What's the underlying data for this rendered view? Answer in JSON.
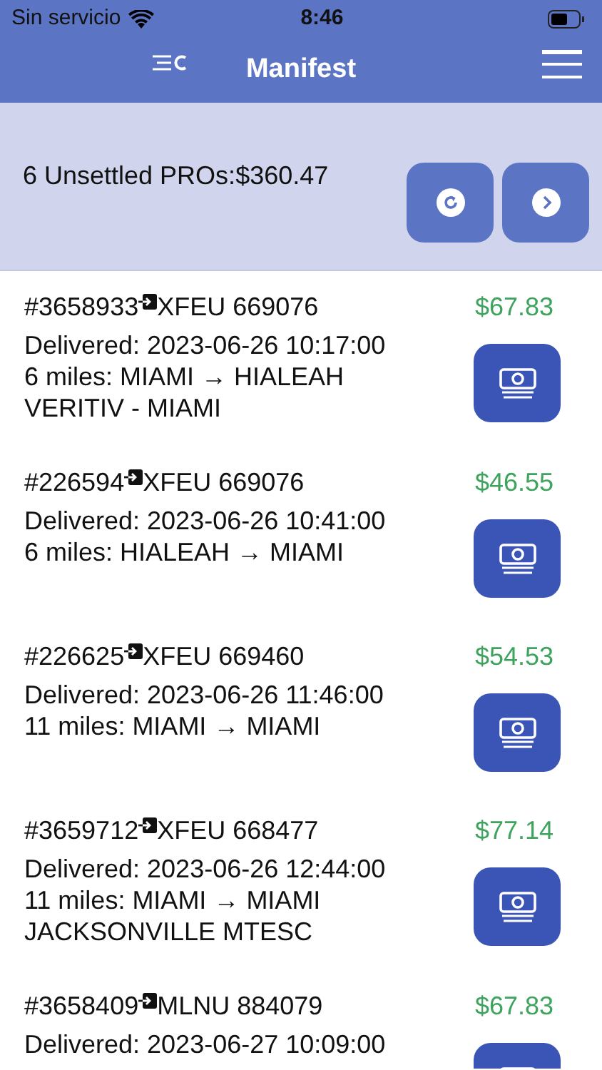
{
  "status_bar": {
    "carrier": "Sin servicio",
    "time": "8:46"
  },
  "header": {
    "title": "Manifest"
  },
  "summary": {
    "text": "6 Unsettled PROs:$360.47"
  },
  "shipments": [
    {
      "pro": "#3658933",
      "container": "XFEU 669076",
      "amount": "$67.83",
      "delivered": "Delivered: 2023-06-26 10:17:00",
      "route": "6 miles: MIAMI → HIALEAH",
      "consignee": "VERITIV - MIAMI"
    },
    {
      "pro": "#226594",
      "container": "XFEU 669076",
      "amount": "$46.55",
      "delivered": "Delivered: 2023-06-26 10:41:00",
      "route": "6 miles: HIALEAH → MIAMI"
    },
    {
      "pro": "#226625",
      "container": "XFEU 669460",
      "amount": "$54.53",
      "delivered": "Delivered: 2023-06-26 11:46:00",
      "route": "11 miles: MIAMI → MIAMI"
    },
    {
      "pro": "#3659712",
      "container": "XFEU 668477",
      "amount": "$77.14",
      "delivered": "Delivered: 2023-06-26 12:44:00",
      "route": "11 miles: MIAMI → MIAMI",
      "consignee": "JACKSONVILLE MTESC"
    },
    {
      "pro": "#3658409",
      "container": "MLNU 884079",
      "amount": "$67.83",
      "delivered": "Delivered: 2023-06-27 10:09:00"
    }
  ]
}
